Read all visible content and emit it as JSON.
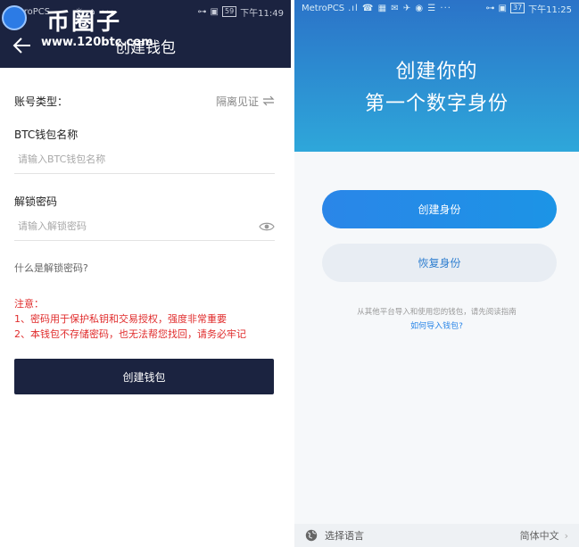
{
  "left": {
    "statusbar": {
      "carrier": "MetroPCS",
      "battery": "59",
      "time": "下午11:49"
    },
    "navbar": {
      "title": "创建钱包"
    },
    "watermark": {
      "brand": "币圈子",
      "url": "www.120btc.com"
    },
    "account_type": {
      "label": "账号类型：",
      "value": "隔离见证"
    },
    "wallet_name": {
      "label": "BTC钱包名称",
      "placeholder": "请输入BTC钱包名称"
    },
    "password": {
      "label": "解锁密码",
      "placeholder": "请输入解锁密码"
    },
    "what_is_password": "什么是解锁密码?",
    "notice": {
      "title": "注意：",
      "line1": "1、密码用于保护私钥和交易授权，强度非常重要",
      "line2": "2、本钱包不存储密码，也无法帮您找回，请务必牢记"
    },
    "create_button": "创建钱包"
  },
  "right": {
    "statusbar": {
      "carrier": "MetroPCS",
      "battery": "37",
      "time": "下午11:25"
    },
    "hero": {
      "line1": "创建你的",
      "line2": "第一个数字身份"
    },
    "create_id_button": "创建身份",
    "restore_id_button": "恢复身份",
    "import_hint": "从其他平台导入和使用您的钱包，请先阅读指南",
    "import_link": "如何导入钱包?",
    "language": {
      "label": "选择语言",
      "current": "简体中文"
    }
  },
  "colors": {
    "navy": "#1b2340",
    "blue": "#2a86e8",
    "warning_red": "#e02c2c"
  }
}
